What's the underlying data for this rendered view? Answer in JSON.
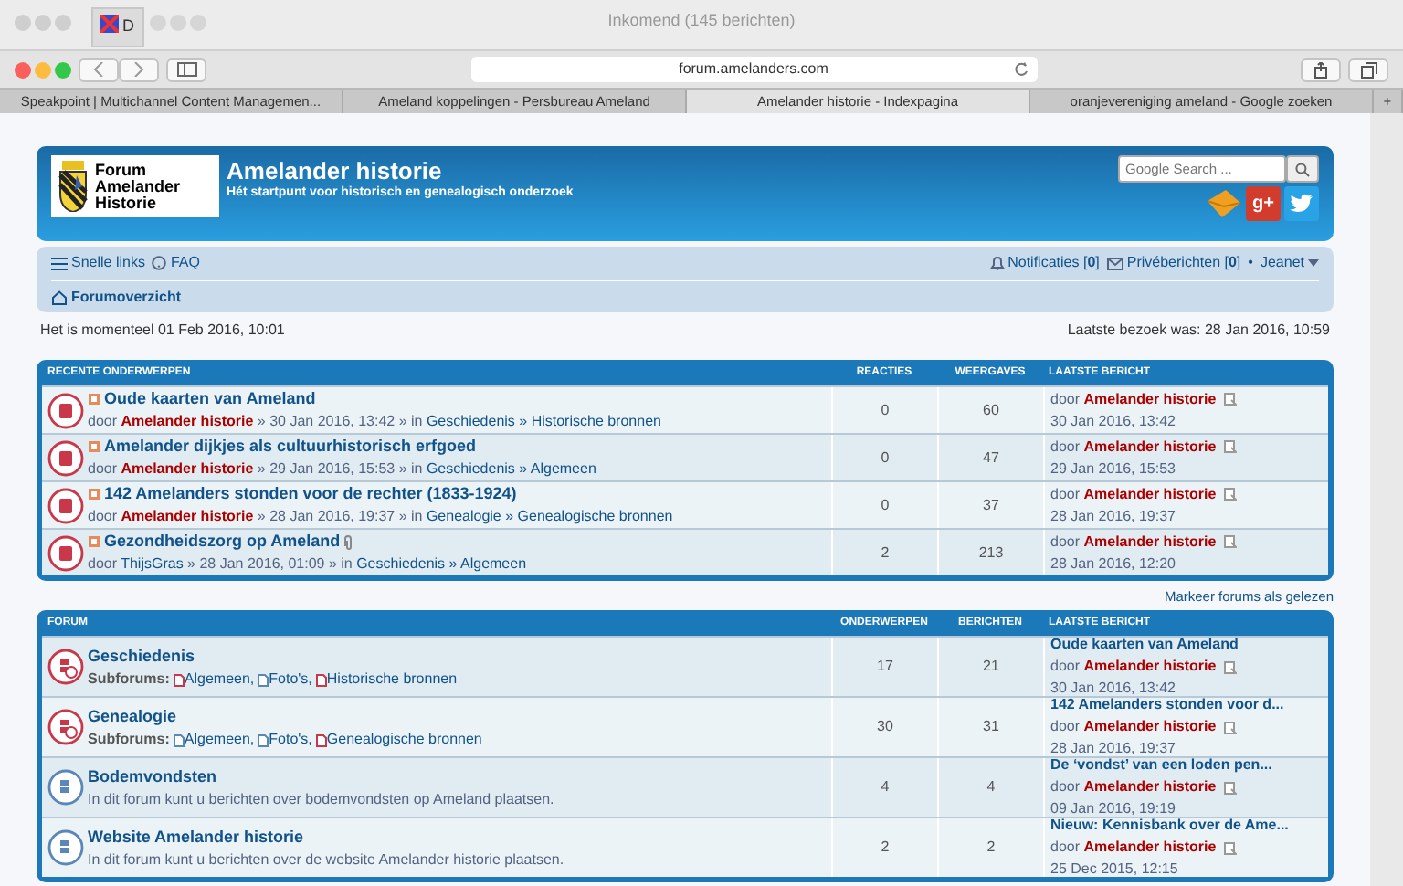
{
  "browser": {
    "background_window_title": "Inkomend (145 berichten)",
    "background_tab_label": "D",
    "address": "forum.amelanders.com",
    "tabs": [
      {
        "label": "Speakpoint | Multichannel Content Managemen...",
        "selected": false
      },
      {
        "label": "Ameland koppelingen - Persbureau Ameland",
        "selected": false
      },
      {
        "label": "Amelander historie - Indexpagina",
        "selected": true
      },
      {
        "label": "oranjevereniging ameland - Google zoeken",
        "selected": false
      }
    ],
    "new_tab": "+"
  },
  "header": {
    "logo_lines": [
      "Forum",
      "Amelander",
      "Historie"
    ],
    "title": "Amelander historie",
    "subtitle": "Hét startpunt voor historisch en genealogisch onderzoek",
    "search_placeholder": "Google Search ...",
    "gplus": "g+"
  },
  "navbar": {
    "quick_links": "Snelle links",
    "faq": "FAQ",
    "notifications": "Notificaties [**0**]",
    "messages": "Privéberichten [**0**]",
    "dot": "•",
    "user": "Jeanet",
    "breadcrumb": "Forumoverzicht"
  },
  "times": {
    "current": "Het is momenteel 01 Feb 2016, 10:01",
    "last_visit": "Laatste bezoek was: 28 Jan 2016, 10:59"
  },
  "recent": {
    "columns": [
      "RECENTE ONDERWERPEN",
      "REACTIES",
      "WEERGAVES",
      "LAATSTE BERICHT"
    ],
    "topics": [
      {
        "title": "Oude kaarten van Ameland",
        "attachment": false,
        "by": "door",
        "author": "Amelander historie",
        "color": "#aa0000",
        "when": "» 30 Jan 2016, 13:42 » in",
        "path": "Geschiedenis » Historische bronnen",
        "replies": "0",
        "views": "60",
        "last_by": "door",
        "last_author": "Amelander historie",
        "last_date": "30 Jan 2016, 13:42"
      },
      {
        "title": "Amelander dijkjes als cultuurhistorisch erfgoed",
        "attachment": false,
        "by": "door",
        "author": "Amelander historie",
        "color": "#aa0000",
        "when": "» 29 Jan 2016, 15:53 » in",
        "path": "Geschiedenis » Algemeen",
        "replies": "0",
        "views": "47",
        "last_by": "door",
        "last_author": "Amelander historie",
        "last_date": "29 Jan 2016, 15:53"
      },
      {
        "title": "142 Amelanders stonden voor de rechter (1833-1924)",
        "attachment": false,
        "by": "door",
        "author": "Amelander historie",
        "color": "#aa0000",
        "when": "» 28 Jan 2016, 19:37 » in",
        "path": "Genealogie » Genealogische bronnen",
        "replies": "0",
        "views": "37",
        "last_by": "door",
        "last_author": "Amelander historie",
        "last_date": "28 Jan 2016, 19:37"
      },
      {
        "title": "Gezondheidszorg op Ameland",
        "attachment": true,
        "by": "door",
        "author": "ThijsGras",
        "color": "#105289",
        "when": "» 28 Jan 2016, 01:09 » in",
        "path": "Geschiedenis » Algemeen",
        "replies": "2",
        "views": "213",
        "last_by": "door",
        "last_author": "Amelander historie",
        "last_date": "28 Jan 2016, 12:20"
      }
    ]
  },
  "mark_read": "Markeer forums als gelezen",
  "forums": {
    "columns": [
      "FORUM",
      "ONDERWERPEN",
      "BERICHTEN",
      "LAATSTE BERICHT"
    ],
    "items": [
      {
        "name": "Geschiedenis",
        "unread": true,
        "subforums_label": "Subforums:",
        "subforums": [
          {
            "name": "Algemeen,",
            "unread": true
          },
          {
            "name": "Foto's,",
            "unread": false
          },
          {
            "name": "Historische bronnen",
            "unread": true
          }
        ],
        "topics": "17",
        "posts": "21",
        "last_title": "Oude kaarten van Ameland",
        "last_by": "door",
        "last_author": "Amelander historie",
        "last_date": "30 Jan 2016, 13:42"
      },
      {
        "name": "Genealogie",
        "unread": true,
        "subforums_label": "Subforums:",
        "subforums": [
          {
            "name": "Algemeen,",
            "unread": false
          },
          {
            "name": "Foto's,",
            "unread": false
          },
          {
            "name": "Genealogische bronnen",
            "unread": true
          }
        ],
        "topics": "30",
        "posts": "31",
        "last_title": "142 Amelanders stonden voor d...",
        "last_by": "door",
        "last_author": "Amelander historie",
        "last_date": "28 Jan 2016, 19:37"
      },
      {
        "name": "Bodemvondsten",
        "unread": false,
        "description": "In dit forum kunt u berichten over bodemvondsten op Ameland plaatsen.",
        "topics": "4",
        "posts": "4",
        "last_title": "De ‘vondst’ van een loden pen...",
        "last_by": "door",
        "last_author": "Amelander historie",
        "last_date": "09 Jan 2016, 19:19"
      },
      {
        "name": "Website Amelander historie",
        "unread": false,
        "description": "In dit forum kunt u berichten over de website Amelander historie plaatsen.",
        "topics": "2",
        "posts": "2",
        "last_title": "Nieuw: Kennisbank over de Ame...",
        "last_by": "door",
        "last_author": "Amelander historie",
        "last_date": "25 Dec 2015, 12:15"
      }
    ]
  }
}
